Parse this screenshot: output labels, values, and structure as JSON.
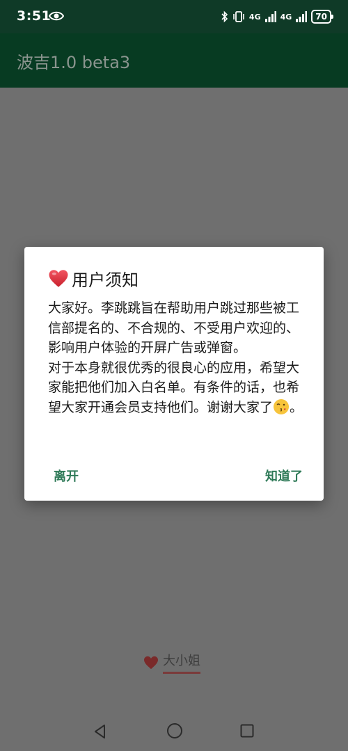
{
  "status_bar": {
    "time": "3:51",
    "battery": "70",
    "signal_1": "4G",
    "signal_2": "4G"
  },
  "app_bar": {
    "title": "波吉1.0 beta3"
  },
  "dialog": {
    "title": "用户须知",
    "paragraph_1": "大家好。李跳跳旨在帮助用户跳过那些被工信部提名的、不合规的、不受用户欢迎的、影响用户体验的开屏广告或弹窗。",
    "paragraph_2": "对于本身就很优秀的很良心的应用，希望大家能把他们加入白名单。有条件的话，也希望大家开通会员支持他们。谢谢大家了",
    "paragraph_2_end": "。",
    "leave_button": "离开",
    "ok_button": "知道了"
  },
  "bottom_tab": {
    "label": "大小姐"
  },
  "icons": {
    "status_left": "eye-icon",
    "status_right": [
      "bluetooth-icon",
      "vibrate-icon",
      "signal-icon",
      "signal-icon",
      "battery-icon"
    ],
    "dialog_title": "heart-icon",
    "dialog_body_emoji": "kissing-face-emoji-icon",
    "bottom_tab": "heart-icon",
    "nav": [
      "back-icon",
      "home-icon",
      "recents-icon"
    ]
  },
  "colors": {
    "status_bar_bg": "#0f3a27",
    "app_bar_bg": "#073b22",
    "scrim_bg": "#6f6f6f",
    "dialog_button": "#2f7a58",
    "heart": "#e0313c"
  }
}
